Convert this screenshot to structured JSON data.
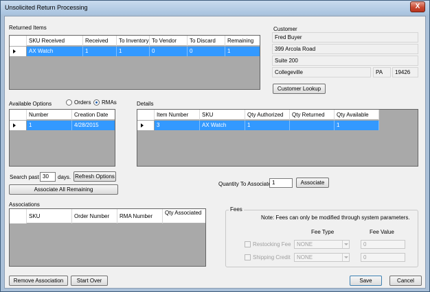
{
  "window": {
    "title": "Unsolicited Return Processing",
    "close_glyph": "X"
  },
  "returned_items": {
    "label": "Returned Items",
    "columns": [
      "SKU Received",
      "Received",
      "To Inventory",
      "To Vendor",
      "To Discard",
      "Remaining"
    ],
    "rows": [
      {
        "sku": "AX Watch",
        "received": "1",
        "to_inventory": "1",
        "to_vendor": "0",
        "to_discard": "0",
        "remaining": "1"
      }
    ]
  },
  "customer": {
    "label": "Customer",
    "name": "Fred Buyer",
    "address1": "399 Arcola Road",
    "address2": "Suite 200",
    "city": "Collegeville",
    "state": "PA",
    "zip": "19426",
    "lookup_button": "Customer Lookup"
  },
  "available_options": {
    "label": "Available Options",
    "radio_orders": "Orders",
    "radio_rmas": "RMAs",
    "selected": "RMAs",
    "columns": [
      "Number",
      "Creation Date"
    ],
    "rows": [
      {
        "number": "1",
        "creation_date": "4/28/2015"
      }
    ],
    "search_past_label": "Search past",
    "search_days_value": "30",
    "days_label": "days.",
    "refresh_button": "Refresh Options",
    "associate_all_button": "Associate All Remaining"
  },
  "details": {
    "label": "Details",
    "columns": [
      "Item Number",
      "SKU",
      "Qty Authorized",
      "Qty Returned",
      "Qty Available"
    ],
    "rows": [
      {
        "item_number": "3",
        "sku": "AX Watch",
        "qty_authorized": "1",
        "qty_returned": "",
        "qty_available": "1"
      }
    ],
    "qty_to_associate_label": "Quantity To Associate",
    "qty_to_associate_value": "1",
    "associate_button": "Associate"
  },
  "associations": {
    "label": "Associations",
    "columns": [
      "SKU",
      "Order Number",
      "RMA Number",
      "Qty Associated"
    ]
  },
  "fees": {
    "label": "Fees",
    "note": "Note: Fees can only be modified through system parameters.",
    "fee_type_header": "Fee Type",
    "fee_value_header": "Fee Value",
    "restocking_label": "Restocking Fee",
    "restocking_type": "NONE",
    "restocking_value": "0",
    "shipping_label": "Shipping Credit",
    "shipping_type": "NONE",
    "shipping_value": "0"
  },
  "footer": {
    "remove_association_button": "Remove Association",
    "start_over_button": "Start Over",
    "save_button": "Save",
    "cancel_button": "Cancel"
  }
}
